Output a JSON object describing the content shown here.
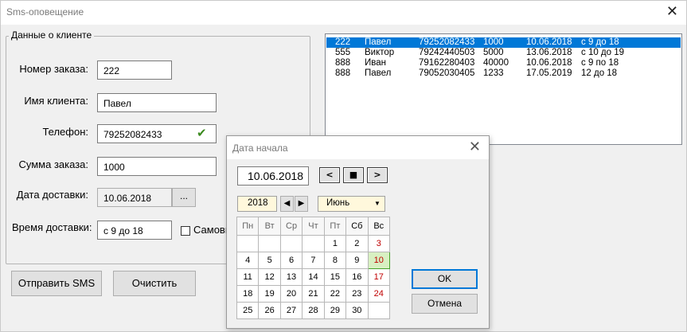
{
  "window": {
    "title": "Sms-оповещение"
  },
  "client_group": {
    "legend": "Данные о клиенте",
    "order_number": {
      "label": "Номер заказа:",
      "value": "222"
    },
    "client_name": {
      "label": "Имя клиента:",
      "value": "Павел"
    },
    "phone": {
      "label": "Телефон:",
      "value": "79252082433"
    },
    "amount": {
      "label": "Сумма заказа:",
      "value": "1000"
    },
    "delivery_date": {
      "label": "Дата доставки:",
      "value": "10.06.2018",
      "picker_label": "..."
    },
    "delivery_time": {
      "label": "Время доставки:",
      "value": "с 9 до 18"
    },
    "pickup": {
      "label": "Самовывоз"
    }
  },
  "buttons": {
    "send_sms": "Отправить SMS",
    "clear": "Очистить"
  },
  "orders": [
    {
      "order": "222",
      "name": "Павел",
      "phone": "79252082433",
      "amount": "1000",
      "date": "10.06.2018",
      "time": "с 9 до 18",
      "selected": true
    },
    {
      "order": "555",
      "name": "Виктор",
      "phone": "79242440503",
      "amount": "5000",
      "date": "13.06.2018",
      "time": "с 10 до 19",
      "selected": false
    },
    {
      "order": "888",
      "name": "Иван",
      "phone": "79162280403",
      "amount": "40000",
      "date": "10.06.2018",
      "time": "с 9 по 18",
      "selected": false
    },
    {
      "order": "888",
      "name": "Павел",
      "phone": "79052030405",
      "amount": "1233",
      "date": "17.05.2019",
      "time": "12 до 18",
      "selected": false
    }
  ],
  "calendar": {
    "title": "Дата начала",
    "date": "10.06.2018",
    "year": "2018",
    "month": "Июнь",
    "weekdays": [
      "Пн",
      "Вт",
      "Ср",
      "Чт",
      "Пт",
      "Сб",
      "Вс"
    ],
    "weeks": [
      [
        "",
        "",
        "",
        "",
        "1",
        "2",
        "3"
      ],
      [
        "4",
        "5",
        "6",
        "7",
        "8",
        "9",
        "10"
      ],
      [
        "11",
        "12",
        "13",
        "14",
        "15",
        "16",
        "17"
      ],
      [
        "18",
        "19",
        "20",
        "21",
        "22",
        "23",
        "24"
      ],
      [
        "25",
        "26",
        "27",
        "28",
        "29",
        "30",
        ""
      ]
    ],
    "selected_day": "10",
    "ok": "OK",
    "cancel": "Отмена"
  },
  "colors": {
    "selection": "#0078d7",
    "sunday": "#c00000",
    "today_bg": "#d8f0c2",
    "check": "#3b8a1f"
  }
}
